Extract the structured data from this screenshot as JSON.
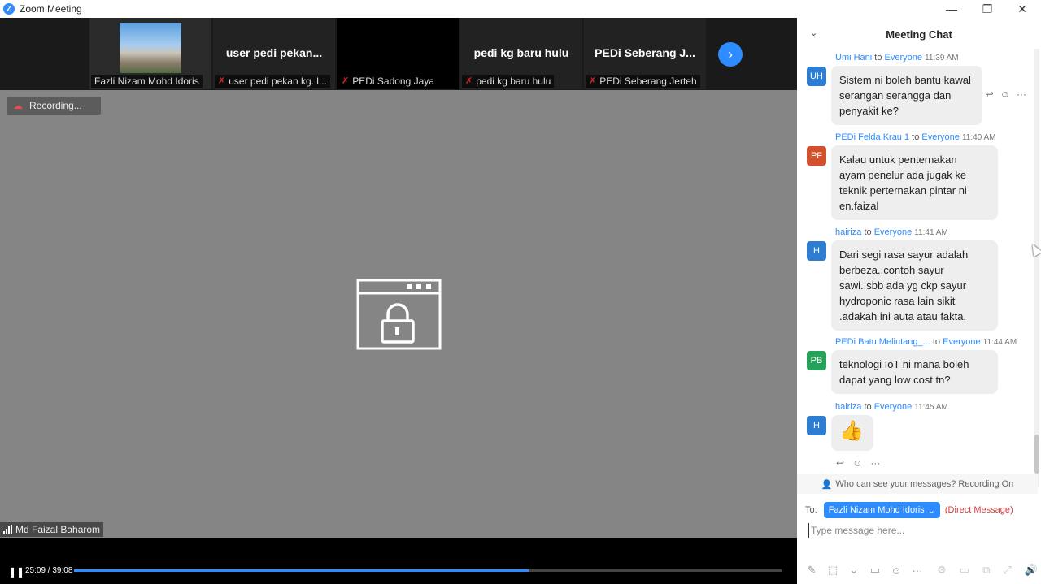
{
  "window": {
    "title": "Zoom Meeting",
    "logo": "Z",
    "minimize_glyph": "—",
    "restore_glyph": "❐",
    "close_glyph": "✕"
  },
  "thumbnails": [
    {
      "big": "",
      "label": "Fazli Nizam Mohd Idoris",
      "muted": false,
      "has_photo": true
    },
    {
      "big": "user  pedi  pekan...",
      "label": "user pedi pekan kg. l...",
      "muted": true,
      "has_photo": false
    },
    {
      "big": "",
      "label": "PEDi Sadong Jaya",
      "muted": true,
      "has_photo": false
    },
    {
      "big": "pedi kg baru hulu",
      "label": "pedi kg baru hulu",
      "muted": true,
      "has_photo": false
    },
    {
      "big": "PEDi  Seberang  J...",
      "label": "PEDi Seberang Jerteh",
      "muted": true,
      "has_photo": false
    }
  ],
  "next_glyph": "›",
  "recording_label": "Recording...",
  "active_speaker": "Md Faizal Baharom",
  "playback": {
    "timecode": "25:09 / 39:08",
    "progress_fraction": 0.6427,
    "play_glyph": "❚❚"
  },
  "chat": {
    "title": "Meeting Chat",
    "collapse_glyph": "⌄",
    "messages": [
      {
        "initials": "UH",
        "color": "#2d7dd2",
        "name": "Umi Hani",
        "to": "Everyone",
        "time": "11:39 AM",
        "lines": [
          "Sistem ni boleh bantu kawal",
          "serangan serangga dan",
          "penyakit ke?"
        ]
      },
      {
        "initials": "PF",
        "color": "#d4502d",
        "name": "PEDi Felda Krau 1",
        "to": "Everyone",
        "time": "11:40 AM",
        "lines": [
          "Kalau untuk penternakan",
          "ayam penelur ada jugak ke",
          "teknik perternakan pintar ni",
          "en.faizal"
        ]
      },
      {
        "initials": "H",
        "color": "#2d7dd2",
        "name": "hairiza",
        "to": "Everyone",
        "time": "11:41 AM",
        "lines": [
          "Dari segi rasa sayur adalah",
          "berbeza..contoh sayur",
          "sawi..sbb ada yg ckp sayur",
          "hydroponic rasa lain sikit",
          ".adakah ini auta atau fakta."
        ]
      },
      {
        "initials": "PB",
        "color": "#26a35b",
        "name": "PEDi Batu Melintang_...",
        "to": "Everyone",
        "time": "11:44 AM",
        "lines": [
          "teknologi IoT ni mana boleh",
          "dapat yang low cost tn?"
        ]
      },
      {
        "initials": "H",
        "color": "#2d7dd2",
        "name": "hairiza",
        "to": "Everyone",
        "time": "11:45 AM",
        "lines": [
          "👍"
        ]
      }
    ],
    "to_word": "to",
    "who_can_see": "Who can see your messages? Recording On",
    "to_label": "To:",
    "recipient": "Fazli Nizam Mohd Idoris",
    "direct_message": "(Direct Message)",
    "input_placeholder": "Type message here...",
    "more_glyph": "···",
    "reply_glyph": "↩",
    "emoji_glyph": "☺"
  }
}
